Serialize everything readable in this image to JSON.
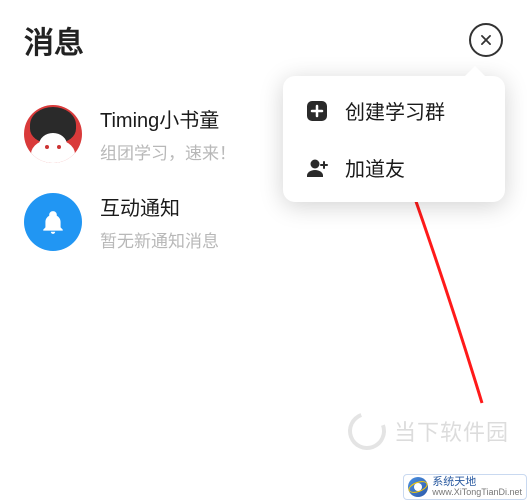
{
  "page_title": "消息",
  "list": [
    {
      "title": "Timing小书童",
      "subtitle": "组团学习，速来！"
    },
    {
      "title": "互动通知",
      "subtitle": "暂无新通知消息"
    }
  ],
  "popover": [
    {
      "label": "创建学习群"
    },
    {
      "label": "加道友"
    }
  ],
  "watermark_text": "当下软件园",
  "footer_badge": {
    "title": "系统天地",
    "url": "www.XiTongTianDi.net"
  }
}
